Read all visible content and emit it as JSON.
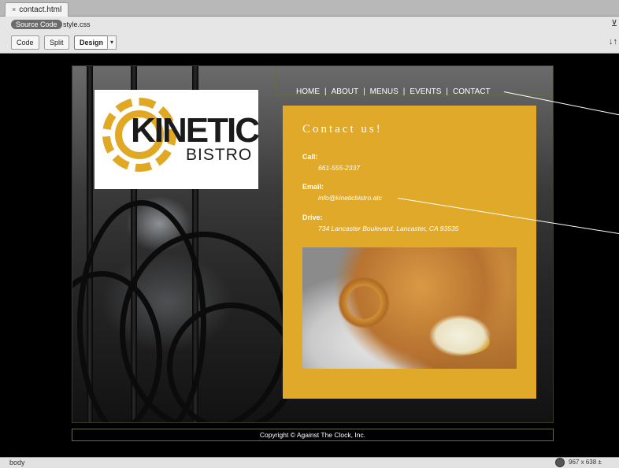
{
  "document_tab": {
    "label": "contact.html",
    "close_glyph": "×"
  },
  "related_files": {
    "source_code": "Source Code",
    "css_file": "style.css"
  },
  "view_buttons": {
    "code": "Code",
    "split": "Split",
    "design": "Design",
    "dropdown_glyph": "▾"
  },
  "page": {
    "logo": {
      "word": "KINETIC",
      "sub": "BISTRO"
    },
    "nav": [
      "HOME",
      "ABOUT",
      "MENUS",
      "EVENTS",
      "CONTACT"
    ],
    "nav_separator": "|",
    "contact": {
      "title": "Contact us!",
      "call_label": "Call:",
      "call_value": "661-555-2337",
      "email_label": "Email:",
      "email_value": "info@kineticbistro.atc",
      "drive_label": "Drive:",
      "drive_value": "734 Lancaster Boulevard, Lancaster, CA 93535"
    },
    "footer": "Copyright © Against The Clock, Inc."
  },
  "status_bar": {
    "tag_selector": "body",
    "window_size": "967 x 638 ±"
  },
  "colors": {
    "panel": "#e0a92a",
    "canvas": "#000000",
    "gear": "#e1a823"
  },
  "icons": {
    "globe": "globe-icon",
    "filter": "filter-icon",
    "arrows": "sort-arrows-icon"
  }
}
